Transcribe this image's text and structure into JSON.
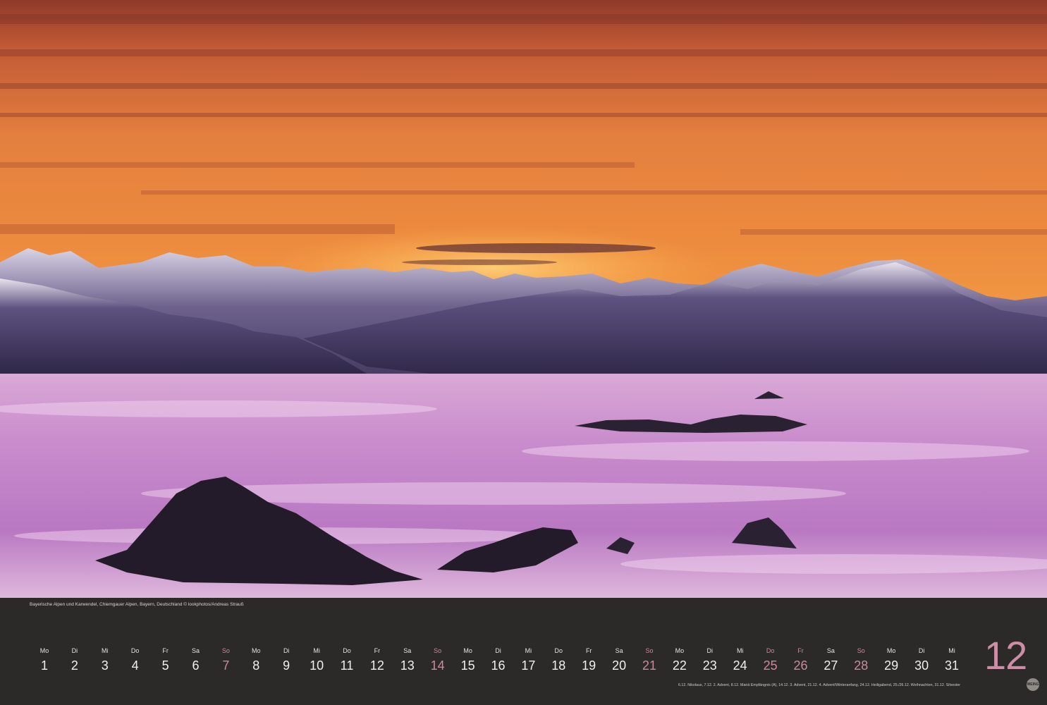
{
  "photo": {
    "subject": "sunset-over-alps-sea-of-fog",
    "caption": "Bayerische Alpen und Karwendel, Chiemgauer Alpen, Bayern, Deutschland © lookphotos/Andreas Strauß"
  },
  "calendar": {
    "month_number": "12",
    "days": [
      {
        "weekday": "Mo",
        "day": "1",
        "sunday_or_holiday": false
      },
      {
        "weekday": "Di",
        "day": "2",
        "sunday_or_holiday": false
      },
      {
        "weekday": "Mi",
        "day": "3",
        "sunday_or_holiday": false
      },
      {
        "weekday": "Do",
        "day": "4",
        "sunday_or_holiday": false
      },
      {
        "weekday": "Fr",
        "day": "5",
        "sunday_or_holiday": false
      },
      {
        "weekday": "Sa",
        "day": "6",
        "sunday_or_holiday": false
      },
      {
        "weekday": "So",
        "day": "7",
        "sunday_or_holiday": true
      },
      {
        "weekday": "Mo",
        "day": "8",
        "sunday_or_holiday": false
      },
      {
        "weekday": "Di",
        "day": "9",
        "sunday_or_holiday": false
      },
      {
        "weekday": "Mi",
        "day": "10",
        "sunday_or_holiday": false
      },
      {
        "weekday": "Do",
        "day": "11",
        "sunday_or_holiday": false
      },
      {
        "weekday": "Fr",
        "day": "12",
        "sunday_or_holiday": false
      },
      {
        "weekday": "Sa",
        "day": "13",
        "sunday_or_holiday": false
      },
      {
        "weekday": "So",
        "day": "14",
        "sunday_or_holiday": true
      },
      {
        "weekday": "Mo",
        "day": "15",
        "sunday_or_holiday": false
      },
      {
        "weekday": "Di",
        "day": "16",
        "sunday_or_holiday": false
      },
      {
        "weekday": "Mi",
        "day": "17",
        "sunday_or_holiday": false
      },
      {
        "weekday": "Do",
        "day": "18",
        "sunday_or_holiday": false
      },
      {
        "weekday": "Fr",
        "day": "19",
        "sunday_or_holiday": false
      },
      {
        "weekday": "Sa",
        "day": "20",
        "sunday_or_holiday": false
      },
      {
        "weekday": "So",
        "day": "21",
        "sunday_or_holiday": true
      },
      {
        "weekday": "Mo",
        "day": "22",
        "sunday_or_holiday": false
      },
      {
        "weekday": "Di",
        "day": "23",
        "sunday_or_holiday": false
      },
      {
        "weekday": "Mi",
        "day": "24",
        "sunday_or_holiday": false
      },
      {
        "weekday": "Do",
        "day": "25",
        "sunday_or_holiday": true
      },
      {
        "weekday": "Fr",
        "day": "26",
        "sunday_or_holiday": true
      },
      {
        "weekday": "Sa",
        "day": "27",
        "sunday_or_holiday": false
      },
      {
        "weekday": "So",
        "day": "28",
        "sunday_or_holiday": true
      },
      {
        "weekday": "Mo",
        "day": "29",
        "sunday_or_holiday": false
      },
      {
        "weekday": "Di",
        "day": "30",
        "sunday_or_holiday": false
      },
      {
        "weekday": "Mi",
        "day": "31",
        "sunday_or_holiday": false
      }
    ],
    "holiday_notes": "6.12. Nikolaus, 7.12. 2. Advent, 8.12. Mariä Empfängnis (A), 14.12. 3. Advent, 21.12. 4. Advent/Winteranfang, 24.12. Heiligabend, 25./26.12. Weihnachten, 31.12. Silvester"
  },
  "publisher_logo": "WEING",
  "colors": {
    "band": "#2b2a28",
    "accent": "#cc8da6",
    "text": "#f2efea"
  }
}
